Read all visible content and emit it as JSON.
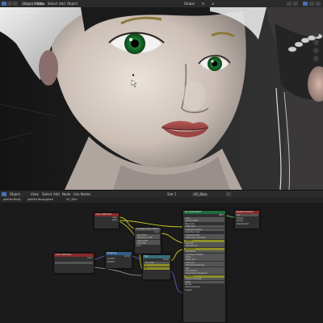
{
  "viewport": {
    "header": {
      "mode": "Object Mode",
      "menus": [
        "View",
        "Select",
        "Add",
        "Object"
      ],
      "transform": "Global",
      "overlay_labels": [
        "↻",
        "⊙"
      ]
    },
    "info": {
      "line1": "User Perspective",
      "line2": "(1) Body | Jolie"
    },
    "icons": [
      "cursor-icon",
      "move-icon",
      "rotate-icon",
      "eye-icon"
    ]
  },
  "node_editor": {
    "header": {
      "editor_type": "Object",
      "menus": [
        "View",
        "Select",
        "Add",
        "Node"
      ],
      "use_nodes": "Use Nodes",
      "slot": "Slot 1",
      "material": "VC_Skin"
    },
    "breadcrumb": [
      "Jolie3w Body",
      "Jolie3w Body.geom",
      "VC_Skin"
    ],
    "nodes": {
      "attr1": {
        "title": "Color Attribute",
        "rows": [
          "Color",
          "Alpha"
        ]
      },
      "attr2": {
        "title": "Color Attribute",
        "rows": [
          "Color"
        ]
      },
      "hue1": {
        "title": "Hue/Saturation/Value",
        "rows": [
          "Color",
          "Hue 0.500",
          "Saturation 1.000",
          "Value 1.000",
          "Fac 1.000",
          "Color"
        ]
      },
      "hue2": {
        "title": "Mix",
        "rows": [
          "Result",
          "Fac 0.500",
          "A",
          "B"
        ]
      },
      "mapping": {
        "title": "Mapping",
        "rows": [
          "Vector",
          "Location",
          "Rotation"
        ]
      },
      "bump": {
        "title": "Normal Map",
        "rows": [
          "Normal",
          "Strength 1.000",
          "Color"
        ]
      },
      "bsdf": {
        "title": "Principled BSDF",
        "rows": [
          "BSDF",
          "GGX",
          "Random Walk",
          "Base Color",
          "Subsurface",
          "Subsurface Radius",
          "Subsurface Color",
          "Subsurface IOR",
          "Subsurface Anisotropy",
          "Metallic",
          "Specular",
          "Specular Tint",
          "Roughness",
          "Anisotropic",
          "Anisotropic Rotation",
          "Sheen",
          "Sheen Tint",
          "Clearcoat",
          "Clearcoat Roughness",
          "IOR",
          "Transmission",
          "Transmission Roughness",
          "Emission",
          "Emission Strength",
          "Alpha",
          "Normal",
          "Clearcoat Normal",
          "Tangent"
        ]
      },
      "output": {
        "title": "Material Output",
        "rows": [
          "All",
          "Surface",
          "Volume",
          "Displacement"
        ]
      }
    }
  }
}
